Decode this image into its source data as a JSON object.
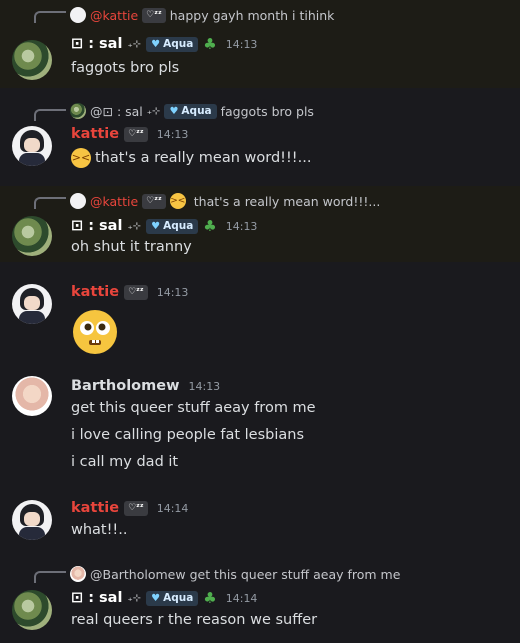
{
  "messages": [
    {
      "reply": {
        "user_mention": "@kattie",
        "status_badge": "♡ᶻᶻ",
        "text": "happy gayh month i tihink"
      },
      "author": "⊡ : sal",
      "decor": "₊⊹",
      "tag": "Aqua",
      "time": "14:13",
      "text": "faggots bro pls"
    },
    {
      "reply": {
        "user_mention": "@⊡ : sal",
        "decor": "₊⊹",
        "tag": "Aqua",
        "text": "faggots bro pls"
      },
      "author": "kattie",
      "status_badge": "♡ᶻᶻ",
      "time": "14:13",
      "text": "that's a really mean word!!!..."
    },
    {
      "reply": {
        "user_mention": "@kattie",
        "status_badge": "♡ᶻᶻ",
        "text": "that's a really mean word!!!..."
      },
      "author": "⊡ : sal",
      "decor": "₊⊹",
      "tag": "Aqua",
      "time": "14:13",
      "text": "oh shut it tranny"
    },
    {
      "author": "kattie",
      "status_badge": "♡ᶻᶻ",
      "time": "14:13"
    },
    {
      "author": "Bartholomew",
      "time": "14:13",
      "lines": [
        "get this queer stuff aeay from me",
        "i love calling people fat lesbians",
        "i call my dad it"
      ]
    },
    {
      "author": "kattie",
      "status_badge": "♡ᶻᶻ",
      "time": "14:14",
      "text": "what!!.."
    },
    {
      "reply": {
        "user_mention": "@Bartholomew",
        "text": "get this queer stuff aeay from me"
      },
      "author": "⊡ : sal",
      "decor": "₊⊹",
      "tag": "Aqua",
      "time": "14:14",
      "text": "real queers r the reason we suffer"
    }
  ]
}
